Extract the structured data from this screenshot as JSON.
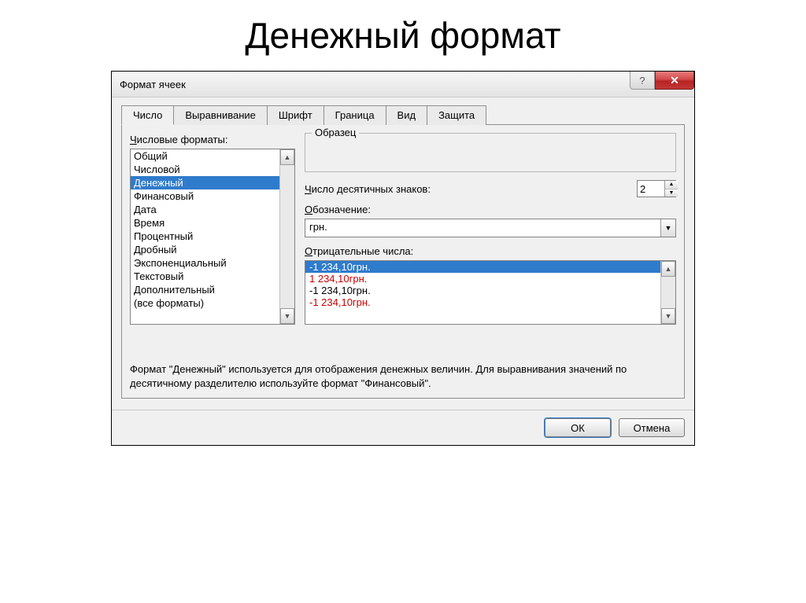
{
  "slide_title": "Денежный формат",
  "window": {
    "title": "Формат ячеек",
    "help_symbol": "?",
    "close_symbol": "✕"
  },
  "tabs": [
    "Число",
    "Выравнивание",
    "Шрифт",
    "Граница",
    "Вид",
    "Защита"
  ],
  "active_tab_index": 0,
  "formats_label_prefix": "Ч",
  "formats_label_rest": "исловые форматы:",
  "formats": [
    "Общий",
    "Числовой",
    "Денежный",
    "Финансовый",
    "Дата",
    "Время",
    "Процентный",
    "Дробный",
    "Экспоненциальный",
    "Текстовый",
    "Дополнительный",
    "(все форматы)"
  ],
  "formats_selected_index": 2,
  "sample_label": "Образец",
  "decimals_label_prefix": "Ч",
  "decimals_label_rest": "исло десятичных знаков:",
  "decimals_value": "2",
  "symbol_label_prefix": "О",
  "symbol_label_rest": "бозначение:",
  "symbol_value": "грн.",
  "neg_label_prefix": "О",
  "neg_label_rest": "трицательные числа:",
  "neg_items": [
    {
      "text": "-1 234,10грн.",
      "red": false,
      "selected": true
    },
    {
      "text": "1 234,10грн.",
      "red": true,
      "selected": false
    },
    {
      "text": "-1 234,10грн.",
      "red": false,
      "selected": false
    },
    {
      "text": "-1 234,10грн.",
      "red": true,
      "selected": false
    }
  ],
  "description": "Формат \"Денежный\" используется для отображения денежных величин. Для выравнивания значений по десятичному разделителю используйте формат \"Финансовый\".",
  "buttons": {
    "ok": "ОК",
    "cancel": "Отмена"
  },
  "arrows": {
    "up": "▲",
    "down": "▼"
  }
}
